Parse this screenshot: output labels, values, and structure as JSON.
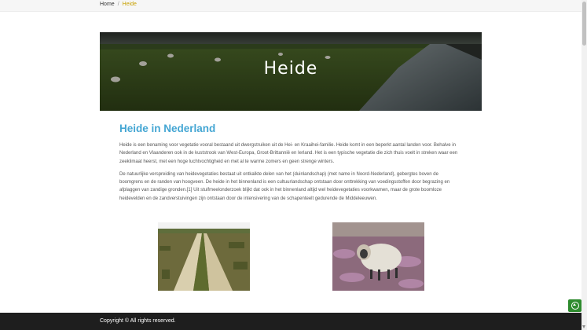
{
  "breadcrumb": {
    "home": "Home",
    "separator": "/",
    "current": "Heide"
  },
  "hero": {
    "title": "Heide"
  },
  "article": {
    "heading": "Heide in Nederland",
    "paragraphs": [
      "Heide is een benaming voor vegetatie vooral bestaand uit dwergstruiken uit de Hei- en Kraaihei-familie. Heide komt in een beperkt aantal landen voor. Behalve in Nederland en Vlaanderen ook in de kuststrook van West-Europa, Groot-Brittannië en Ierland. Het is een typische vegetatie die zich thuis voelt in streken waar een zeeklimaat heerst, met een hoge luchtvochtigheid en met al te warme zomers en geen strenge winters.",
      "De natuurlijke verspreiding van heidevegetaties bestaat uit ontkalkte delen van het (duinlandschap) (met name in Noord-Nederland), gebergtes boven de boomgrens en de randen van hoogveen. De heide in het binnenland is een cultuurlandschap ontstaan door onttrekking van voedingsstoffen door begrazing en afplaggen van zandige gronden.[1] Uit stuifmeelonderzoek blijkt dat ook in het binnenland altijd wel heidevegetaties voorkwamen, maar de grote boomloze heidevelden en de zandverstuivingen zijn ontstaan door de intensivering van de schapenteelt gedurende de Middeleeuwen."
    ]
  },
  "footer": {
    "copyright": "Copyright © All rights reserved."
  },
  "colors": {
    "accent": "#44a6d3",
    "breadcrumb_current": "#c8a000",
    "footer_bg": "#1e1e1e",
    "fab_bg": "#2e8b2e"
  },
  "icons": {
    "back_to_top": "arrow-up-circle-icon"
  }
}
